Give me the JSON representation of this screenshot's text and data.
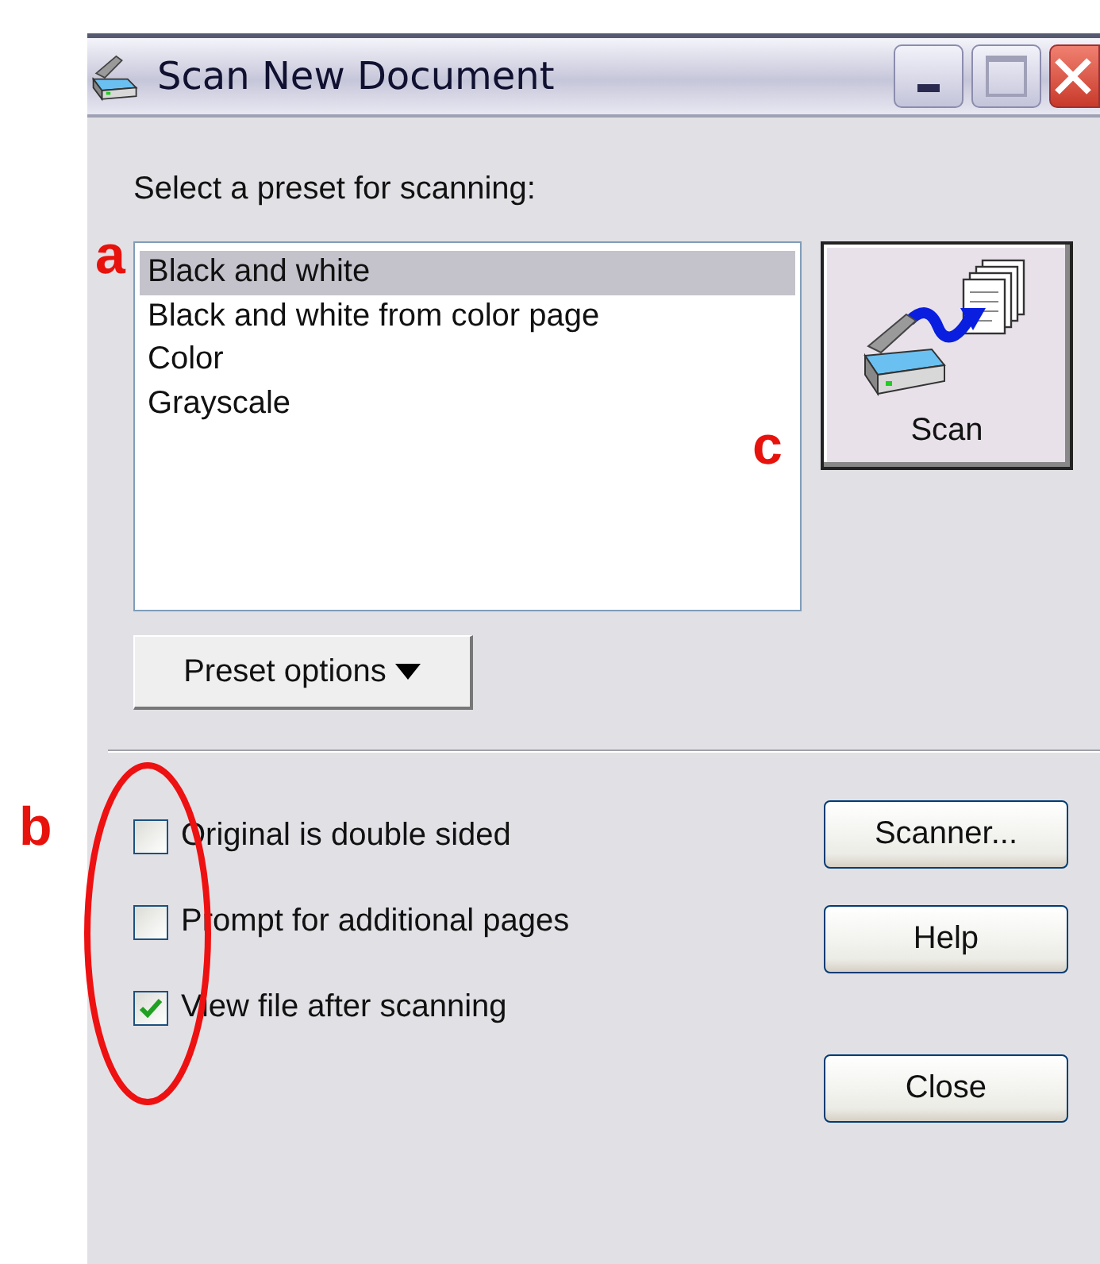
{
  "window": {
    "title": "Scan New Document"
  },
  "prompt": "Select a preset for scanning:",
  "presets": [
    {
      "label": "Black and white",
      "selected": true
    },
    {
      "label": "Black and white from color page",
      "selected": false
    },
    {
      "label": "Color",
      "selected": false
    },
    {
      "label": "Grayscale",
      "selected": false
    }
  ],
  "scan_button": {
    "label": "Scan"
  },
  "preset_options_button": {
    "label": "Preset options"
  },
  "options": [
    {
      "label": "Original is double sided",
      "checked": false
    },
    {
      "label": "Prompt for additional pages",
      "checked": false
    },
    {
      "label": "View file after scanning",
      "checked": true
    }
  ],
  "buttons": [
    "Scanner...",
    "Help",
    "Close"
  ],
  "annotations": [
    {
      "label": "a"
    },
    {
      "label": "b"
    },
    {
      "label": "c"
    }
  ]
}
